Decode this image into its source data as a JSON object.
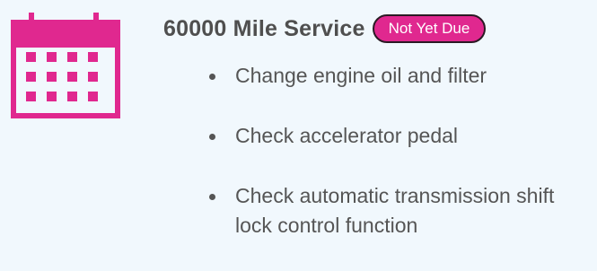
{
  "service": {
    "title": "60000 Mile Service",
    "status": "Not Yet Due",
    "icon": "calendar-icon"
  },
  "tasks": [
    {
      "label": "Change engine oil and filter"
    },
    {
      "label": "Check accelerator pedal"
    },
    {
      "label": "Check automatic transmission shift lock control function"
    }
  ],
  "colors": {
    "accent": "#e0288f",
    "background": "#f1f8fd",
    "text": "#555555",
    "title": "#4f4f4f"
  }
}
